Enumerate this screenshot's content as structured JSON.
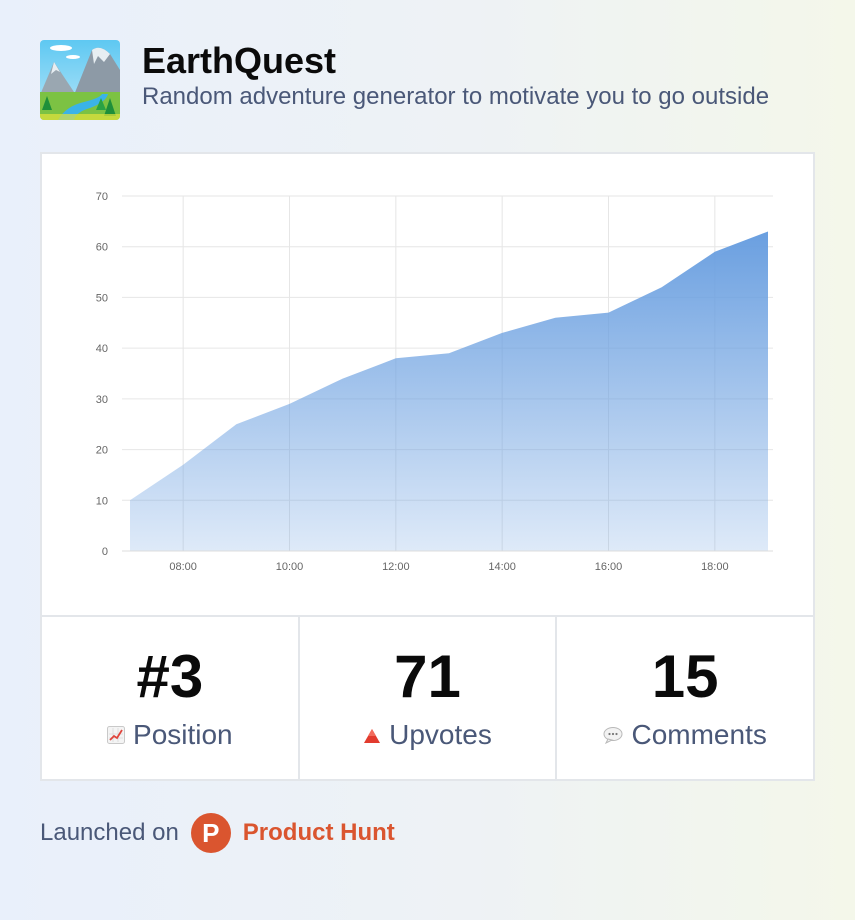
{
  "app": {
    "title": "EarthQuest",
    "tagline": "Random adventure generator to motivate you to go outside",
    "logo_icon": "mountain-river-landscape-icon"
  },
  "chart_data": {
    "type": "area",
    "title": "",
    "xlabel": "",
    "ylabel": "",
    "x": [
      "07:00",
      "08:00",
      "09:00",
      "10:00",
      "11:00",
      "12:00",
      "13:00",
      "14:00",
      "15:00",
      "16:00",
      "17:00",
      "18:00",
      "19:00"
    ],
    "x_tick_labels": [
      "08:00",
      "10:00",
      "12:00",
      "14:00",
      "16:00",
      "18:00"
    ],
    "values": [
      10,
      17,
      25,
      29,
      34,
      38,
      39,
      43,
      46,
      47,
      52,
      59,
      63
    ],
    "ylim": [
      0,
      70
    ],
    "yticks": [
      0,
      10,
      20,
      30,
      40,
      50,
      60,
      70
    ],
    "grid": true,
    "legend": "none",
    "color": "#6a9fe0"
  },
  "stats": [
    {
      "value": "#3",
      "label": "Position",
      "icon": "chart-increasing-icon"
    },
    {
      "value": "71",
      "label": "Upvotes",
      "icon": "red-triangle-up-icon"
    },
    {
      "value": "15",
      "label": "Comments",
      "icon": "speech-bubble-icon"
    }
  ],
  "footer": {
    "launched_label": "Launched on",
    "platform_logo_letter": "P",
    "platform_name": "Product Hunt",
    "brand_color": "#da552f"
  }
}
